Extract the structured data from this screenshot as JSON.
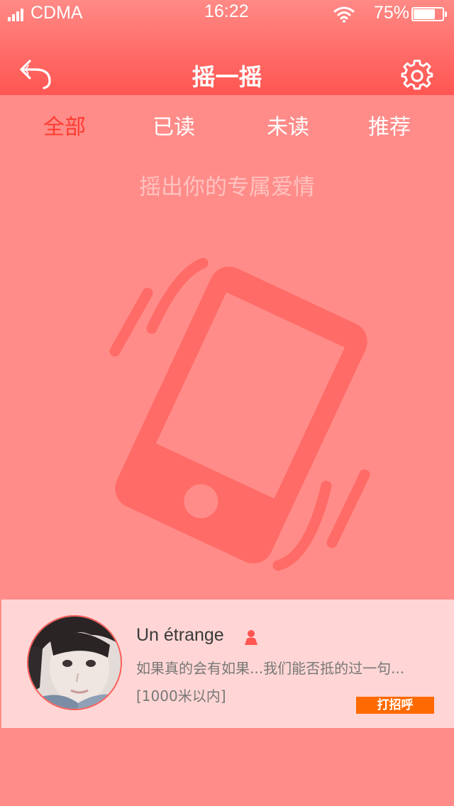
{
  "status_bar": {
    "carrier": "CDMA",
    "time": "16:22",
    "battery_percent_label": "75%",
    "battery_level": 0.75,
    "signal_bars": 4
  },
  "header": {
    "title": "摇一摇",
    "back_icon": "back-arrow-icon",
    "settings_icon": "gear-icon"
  },
  "tabs": [
    {
      "label": "全部",
      "active": true
    },
    {
      "label": "已读",
      "active": false
    },
    {
      "label": "未读",
      "active": false
    },
    {
      "label": "推荐",
      "active": false
    }
  ],
  "main": {
    "hint": "摇出你的专属爱情",
    "graphic_icon": "shaking-phone-icon"
  },
  "result": {
    "name": "Un étrange",
    "gender_icon": "female-user-icon",
    "signature": "如果真的会有如果...我们能否抵的过一句...",
    "distance": "[1000米以内]",
    "greet_label": "打招呼"
  },
  "colors": {
    "background": "#ff8c89",
    "header": "#ff5652",
    "active_tab": "#ff3b30",
    "graphic": "#ff6b67",
    "card": "#ffd6d5",
    "greet_button": "#ff6a00"
  }
}
